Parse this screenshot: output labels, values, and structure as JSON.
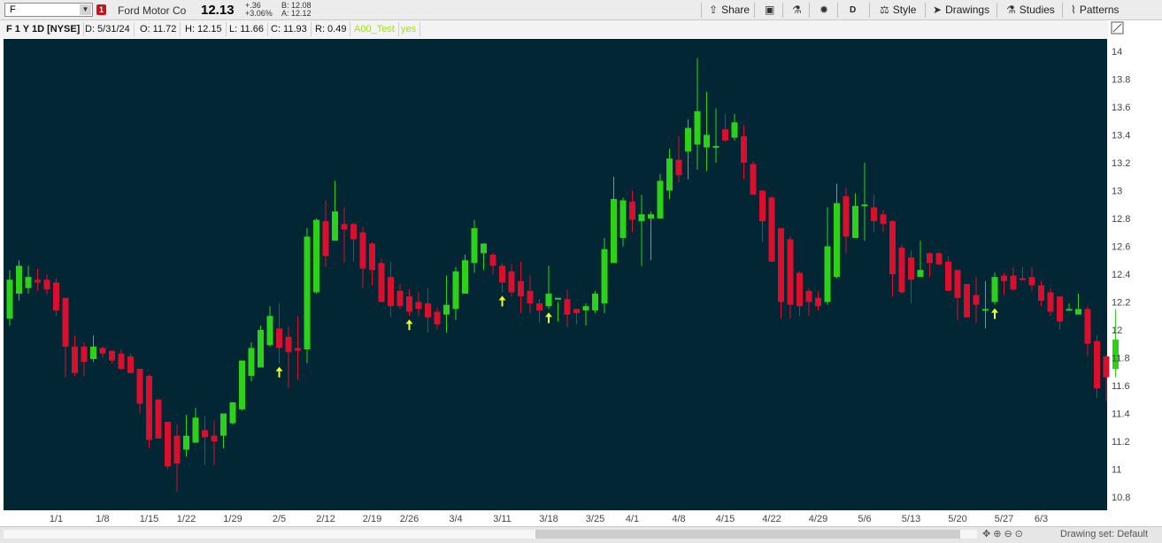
{
  "header": {
    "symbol": "F",
    "alert_count": "1",
    "company": "Ford Motor Co",
    "last": "12.13",
    "change": "+.36",
    "change_pct": "+3.06%",
    "bid": "B: 12.08",
    "ask": "A: 12.12",
    "toolbar": {
      "share": "Share",
      "aggregation": "D",
      "style": "Style",
      "drawings": "Drawings",
      "studies": "Studies",
      "patterns": "Patterns"
    }
  },
  "info_bar": {
    "title": "F 1 Y 1D [NYSE]",
    "date": "D: 5/31/24",
    "open": "O: 11.72",
    "high": "H: 12.15",
    "low": "L: 11.66",
    "close": "C: 11.93",
    "range": "R: 0.49",
    "study_name": "A00_Test",
    "study_value": "yes"
  },
  "footer": {
    "drawing_set": "Drawing set: Default"
  },
  "colors": {
    "background": "#022634",
    "up": "#2ed11a",
    "down": "#d8102e",
    "signal": "#eaff2a",
    "axis_panel": "#ffffff"
  },
  "chart_data": {
    "type": "candlestick",
    "symbol": "F",
    "ylim": [
      10.7,
      14.15
    ],
    "y_ticks": [
      10.8,
      11,
      11.2,
      11.4,
      11.6,
      11.8,
      12,
      12.2,
      12.4,
      12.6,
      12.8,
      13,
      13.2,
      13.4,
      13.6,
      13.8,
      14
    ],
    "y_tick_labels": [
      "10.8",
      "11",
      "11.2",
      "11.4",
      "11.6",
      "11.8",
      "12",
      "12.2",
      "12.4",
      "12.6",
      "12.8",
      "13",
      "13.2",
      "13.4",
      "13.6",
      "13.8",
      "14"
    ],
    "x_ticks": [
      {
        "label": "1/1",
        "index": 5
      },
      {
        "label": "1/8",
        "index": 10
      },
      {
        "label": "1/15",
        "index": 15
      },
      {
        "label": "1/22",
        "index": 19
      },
      {
        "label": "1/29",
        "index": 24
      },
      {
        "label": "2/5",
        "index": 29
      },
      {
        "label": "2/12",
        "index": 34
      },
      {
        "label": "2/19",
        "index": 39
      },
      {
        "label": "2/26",
        "index": 43
      },
      {
        "label": "3/4",
        "index": 48
      },
      {
        "label": "3/11",
        "index": 53
      },
      {
        "label": "3/18",
        "index": 58
      },
      {
        "label": "3/25",
        "index": 63
      },
      {
        "label": "4/1",
        "index": 67
      },
      {
        "label": "4/8",
        "index": 72
      },
      {
        "label": "4/15",
        "index": 77
      },
      {
        "label": "4/22",
        "index": 82
      },
      {
        "label": "4/29",
        "index": 87
      },
      {
        "label": "5/6",
        "index": 92
      },
      {
        "label": "5/13",
        "index": 97
      },
      {
        "label": "5/20",
        "index": 102
      },
      {
        "label": "5/27",
        "index": 107
      },
      {
        "label": "6/3",
        "index": 111
      }
    ],
    "candles": [
      {
        "o": 12.08,
        "h": 12.43,
        "l": 12.03,
        "c": 12.36
      },
      {
        "o": 12.26,
        "h": 12.5,
        "l": 12.21,
        "c": 12.46
      },
      {
        "o": 12.3,
        "h": 12.46,
        "l": 12.26,
        "c": 12.38
      },
      {
        "o": 12.36,
        "h": 12.44,
        "l": 12.28,
        "c": 12.34
      },
      {
        "o": 12.36,
        "h": 12.4,
        "l": 12.25,
        "c": 12.29
      },
      {
        "o": 12.34,
        "h": 12.37,
        "l": 12.1,
        "c": 12.14
      },
      {
        "o": 12.23,
        "h": 12.23,
        "l": 11.66,
        "c": 11.88
      },
      {
        "o": 11.88,
        "h": 11.96,
        "l": 11.67,
        "c": 11.69
      },
      {
        "o": 11.88,
        "h": 11.91,
        "l": 11.67,
        "c": 11.77
      },
      {
        "o": 11.79,
        "h": 11.96,
        "l": 11.77,
        "c": 11.88
      },
      {
        "o": 11.87,
        "h": 11.88,
        "l": 11.8,
        "c": 11.83
      },
      {
        "o": 11.85,
        "h": 11.85,
        "l": 11.76,
        "c": 11.78
      },
      {
        "o": 11.83,
        "h": 11.86,
        "l": 11.71,
        "c": 11.72
      },
      {
        "o": 11.81,
        "h": 11.83,
        "l": 11.69,
        "c": 11.69
      },
      {
        "o": 11.72,
        "h": 11.72,
        "l": 11.4,
        "c": 11.47
      },
      {
        "o": 11.67,
        "h": 11.68,
        "l": 11.15,
        "c": 11.21
      },
      {
        "o": 11.5,
        "h": 11.5,
        "l": 11.22,
        "c": 11.22
      },
      {
        "o": 11.34,
        "h": 11.34,
        "l": 11.0,
        "c": 11.02
      },
      {
        "o": 11.24,
        "h": 11.32,
        "l": 10.84,
        "c": 11.04
      },
      {
        "o": 11.14,
        "h": 11.39,
        "l": 11.09,
        "c": 11.24
      },
      {
        "o": 11.19,
        "h": 11.44,
        "l": 11.19,
        "c": 11.37
      },
      {
        "o": 11.28,
        "h": 11.38,
        "l": 11.03,
        "c": 11.23
      },
      {
        "o": 11.24,
        "h": 11.35,
        "l": 11.03,
        "c": 11.2
      },
      {
        "o": 11.24,
        "h": 11.39,
        "l": 11.15,
        "c": 11.4
      },
      {
        "o": 11.33,
        "h": 11.46,
        "l": 11.32,
        "c": 11.48
      },
      {
        "o": 11.43,
        "h": 11.77,
        "l": 11.42,
        "c": 11.78
      },
      {
        "o": 11.67,
        "h": 11.91,
        "l": 11.63,
        "c": 11.87
      },
      {
        "o": 11.73,
        "h": 12.03,
        "l": 11.73,
        "c": 12.0
      },
      {
        "o": 11.89,
        "h": 12.17,
        "l": 11.88,
        "c": 12.1
      },
      {
        "o": 12.01,
        "h": 12.19,
        "l": 11.76,
        "c": 11.87
      },
      {
        "o": 11.95,
        "h": 12.02,
        "l": 11.58,
        "c": 11.84
      },
      {
        "o": 11.87,
        "h": 12.1,
        "l": 11.64,
        "c": 11.85
      },
      {
        "o": 11.86,
        "h": 12.73,
        "l": 11.76,
        "c": 12.67
      },
      {
        "o": 12.27,
        "h": 12.8,
        "l": 12.26,
        "c": 12.79
      },
      {
        "o": 12.78,
        "h": 12.93,
        "l": 12.45,
        "c": 12.53
      },
      {
        "o": 12.64,
        "h": 13.07,
        "l": 12.64,
        "c": 12.85
      },
      {
        "o": 12.76,
        "h": 12.88,
        "l": 12.48,
        "c": 12.72
      },
      {
        "o": 12.76,
        "h": 12.77,
        "l": 12.49,
        "c": 12.65
      },
      {
        "o": 12.7,
        "h": 12.74,
        "l": 12.3,
        "c": 12.44
      },
      {
        "o": 12.62,
        "h": 12.63,
        "l": 12.32,
        "c": 12.43
      },
      {
        "o": 12.48,
        "h": 12.51,
        "l": 12.28,
        "c": 12.2
      },
      {
        "o": 12.38,
        "h": 12.49,
        "l": 12.09,
        "c": 12.17
      },
      {
        "o": 12.28,
        "h": 12.33,
        "l": 12.15,
        "c": 12.17
      },
      {
        "o": 12.24,
        "h": 12.29,
        "l": 12.1,
        "c": 12.13
      },
      {
        "o": 12.2,
        "h": 12.27,
        "l": 12.1,
        "c": 12.15
      },
      {
        "o": 12.19,
        "h": 12.3,
        "l": 11.98,
        "c": 12.09
      },
      {
        "o": 12.13,
        "h": 12.16,
        "l": 12.0,
        "c": 12.04
      },
      {
        "o": 12.11,
        "h": 12.39,
        "l": 11.98,
        "c": 12.18
      },
      {
        "o": 12.15,
        "h": 12.45,
        "l": 12.07,
        "c": 12.42
      },
      {
        "o": 12.26,
        "h": 12.54,
        "l": 12.26,
        "c": 12.5
      },
      {
        "o": 12.48,
        "h": 12.79,
        "l": 12.41,
        "c": 12.73
      },
      {
        "o": 12.55,
        "h": 12.6,
        "l": 12.43,
        "c": 12.62
      },
      {
        "o": 12.54,
        "h": 12.55,
        "l": 12.4,
        "c": 12.46
      },
      {
        "o": 12.46,
        "h": 12.48,
        "l": 12.27,
        "c": 12.34
      },
      {
        "o": 12.42,
        "h": 12.47,
        "l": 12.24,
        "c": 12.27
      },
      {
        "o": 12.35,
        "h": 12.49,
        "l": 12.12,
        "c": 12.24
      },
      {
        "o": 12.28,
        "h": 12.39,
        "l": 12.12,
        "c": 12.19
      },
      {
        "o": 12.19,
        "h": 12.22,
        "l": 12.05,
        "c": 12.14
      },
      {
        "o": 12.17,
        "h": 12.46,
        "l": 12.15,
        "c": 12.26
      },
      {
        "o": 12.22,
        "h": 12.2,
        "l": 12.06,
        "c": 12.23
      },
      {
        "o": 12.22,
        "h": 12.29,
        "l": 12.02,
        "c": 12.11
      },
      {
        "o": 12.15,
        "h": 12.15,
        "l": 12.04,
        "c": 12.12
      },
      {
        "o": 12.14,
        "h": 12.19,
        "l": 12.03,
        "c": 12.17
      },
      {
        "o": 12.14,
        "h": 12.28,
        "l": 12.12,
        "c": 12.26
      },
      {
        "o": 12.19,
        "h": 12.66,
        "l": 12.12,
        "c": 12.58
      },
      {
        "o": 12.48,
        "h": 13.1,
        "l": 12.5,
        "c": 12.94
      },
      {
        "o": 12.66,
        "h": 12.95,
        "l": 12.6,
        "c": 12.93
      },
      {
        "o": 12.92,
        "h": 13.0,
        "l": 12.7,
        "c": 12.79
      },
      {
        "o": 12.78,
        "h": 12.97,
        "l": 12.46,
        "c": 12.83
      },
      {
        "o": 12.8,
        "h": 12.85,
        "l": 12.5,
        "c": 12.83
      },
      {
        "o": 12.8,
        "h": 13.12,
        "l": 12.81,
        "c": 13.07
      },
      {
        "o": 13.0,
        "h": 13.3,
        "l": 12.94,
        "c": 13.23
      },
      {
        "o": 13.22,
        "h": 13.39,
        "l": 13.06,
        "c": 13.11
      },
      {
        "o": 13.28,
        "h": 13.51,
        "l": 13.08,
        "c": 13.45
      },
      {
        "o": 13.33,
        "h": 13.95,
        "l": 13.15,
        "c": 13.57
      },
      {
        "o": 13.31,
        "h": 13.71,
        "l": 13.14,
        "c": 13.4
      },
      {
        "o": 13.31,
        "h": 13.59,
        "l": 13.2,
        "c": 13.32
      },
      {
        "o": 13.44,
        "h": 13.55,
        "l": 13.35,
        "c": 13.36
      },
      {
        "o": 13.38,
        "h": 13.55,
        "l": 13.36,
        "c": 13.49
      },
      {
        "o": 13.39,
        "h": 13.47,
        "l": 13.08,
        "c": 13.2
      },
      {
        "o": 13.19,
        "h": 13.21,
        "l": 12.97,
        "c": 12.97
      },
      {
        "o": 13.0,
        "h": 13.0,
        "l": 12.63,
        "c": 12.78
      },
      {
        "o": 12.95,
        "h": 12.96,
        "l": 12.5,
        "c": 12.49
      },
      {
        "o": 12.73,
        "h": 12.72,
        "l": 12.08,
        "c": 12.2
      },
      {
        "o": 12.65,
        "h": 12.67,
        "l": 12.08,
        "c": 12.18
      },
      {
        "o": 12.41,
        "h": 12.42,
        "l": 12.1,
        "c": 12.17
      },
      {
        "o": 12.28,
        "h": 12.3,
        "l": 12.1,
        "c": 12.2
      },
      {
        "o": 12.23,
        "h": 12.28,
        "l": 12.14,
        "c": 12.17
      },
      {
        "o": 12.2,
        "h": 12.88,
        "l": 12.18,
        "c": 12.6
      },
      {
        "o": 12.38,
        "h": 13.05,
        "l": 12.37,
        "c": 12.91
      },
      {
        "o": 12.96,
        "h": 13.02,
        "l": 12.55,
        "c": 12.67
      },
      {
        "o": 12.66,
        "h": 12.98,
        "l": 12.66,
        "c": 12.89
      },
      {
        "o": 12.89,
        "h": 13.2,
        "l": 12.64,
        "c": 12.9
      },
      {
        "o": 12.88,
        "h": 12.97,
        "l": 12.7,
        "c": 12.78
      },
      {
        "o": 12.83,
        "h": 12.86,
        "l": 12.7,
        "c": 12.76
      },
      {
        "o": 12.78,
        "h": 12.79,
        "l": 12.24,
        "c": 12.4
      },
      {
        "o": 12.59,
        "h": 12.61,
        "l": 12.26,
        "c": 12.27
      },
      {
        "o": 12.52,
        "h": 12.57,
        "l": 12.19,
        "c": 12.36
      },
      {
        "o": 12.38,
        "h": 12.64,
        "l": 12.38,
        "c": 12.43
      },
      {
        "o": 12.55,
        "h": 12.56,
        "l": 12.38,
        "c": 12.48
      },
      {
        "o": 12.55,
        "h": 12.56,
        "l": 12.47,
        "c": 12.47
      },
      {
        "o": 12.49,
        "h": 12.53,
        "l": 12.28,
        "c": 12.28
      },
      {
        "o": 12.43,
        "h": 12.42,
        "l": 12.07,
        "c": 12.23
      },
      {
        "o": 12.33,
        "h": 12.33,
        "l": 12.09,
        "c": 12.09
      },
      {
        "o": 12.25,
        "h": 12.38,
        "l": 12.05,
        "c": 12.18
      },
      {
        "o": 12.15,
        "h": 12.35,
        "l": 12.01,
        "c": 12.15
      },
      {
        "o": 12.2,
        "h": 12.41,
        "l": 12.18,
        "c": 12.38
      },
      {
        "o": 12.39,
        "h": 12.41,
        "l": 12.25,
        "c": 12.35
      },
      {
        "o": 12.39,
        "h": 12.45,
        "l": 12.28,
        "c": 12.29
      },
      {
        "o": 12.37,
        "h": 12.45,
        "l": 12.36,
        "c": 12.36
      },
      {
        "o": 12.38,
        "h": 12.45,
        "l": 12.28,
        "c": 12.32
      },
      {
        "o": 12.32,
        "h": 12.35,
        "l": 12.17,
        "c": 12.21
      },
      {
        "o": 12.27,
        "h": 12.3,
        "l": 12.1,
        "c": 12.13
      },
      {
        "o": 12.24,
        "h": 12.24,
        "l": 12.0,
        "c": 12.06
      },
      {
        "o": 12.15,
        "h": 12.19,
        "l": 12.14,
        "c": 12.15
      },
      {
        "o": 12.11,
        "h": 12.26,
        "l": 12.13,
        "c": 12.15
      },
      {
        "o": 12.15,
        "h": 12.17,
        "l": 11.81,
        "c": 11.9
      },
      {
        "o": 11.92,
        "h": 11.96,
        "l": 11.51,
        "c": 11.58
      },
      {
        "o": 11.81,
        "h": 11.82,
        "l": 11.49,
        "c": 11.66
      },
      {
        "o": 11.72,
        "h": 12.15,
        "l": 11.66,
        "c": 11.93
      }
    ],
    "signals": [
      29,
      43,
      53,
      58,
      106
    ]
  }
}
